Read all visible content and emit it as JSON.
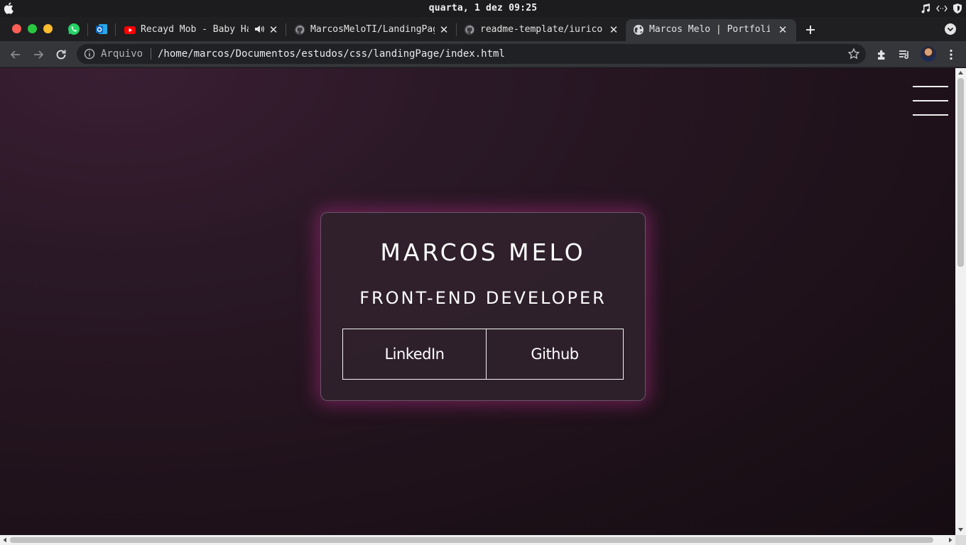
{
  "system": {
    "clock": "quarta,  1 dez 09:25"
  },
  "tabs": [
    {
      "title": "Recayd Mob - Baby Hair",
      "favicon": "youtube-icon",
      "audio": true,
      "active": false
    },
    {
      "title": "MarcosMeloTI/LandingPage",
      "favicon": "github-icon",
      "active": false
    },
    {
      "title": "readme-template/iuricode",
      "favicon": "github-icon",
      "active": false
    },
    {
      "title": "Marcos Melo | Portfolio",
      "favicon": "globe-icon",
      "active": true
    }
  ],
  "pinned_apps": [
    "whatsapp-icon",
    "outlook-icon"
  ],
  "address_bar": {
    "scheme_label": "Arquivo",
    "url": "/home/marcos/Documentos/estudos/css/landingPage/index.html"
  },
  "page": {
    "name": "MARCOS MELO",
    "role": "FRONT-END DEVELOPER",
    "links": [
      {
        "label": "LinkedIn"
      },
      {
        "label": "Github"
      }
    ]
  },
  "colors": {
    "page_bg": "#1e1119",
    "card_glow": "#a02878",
    "text": "#ffffff"
  }
}
